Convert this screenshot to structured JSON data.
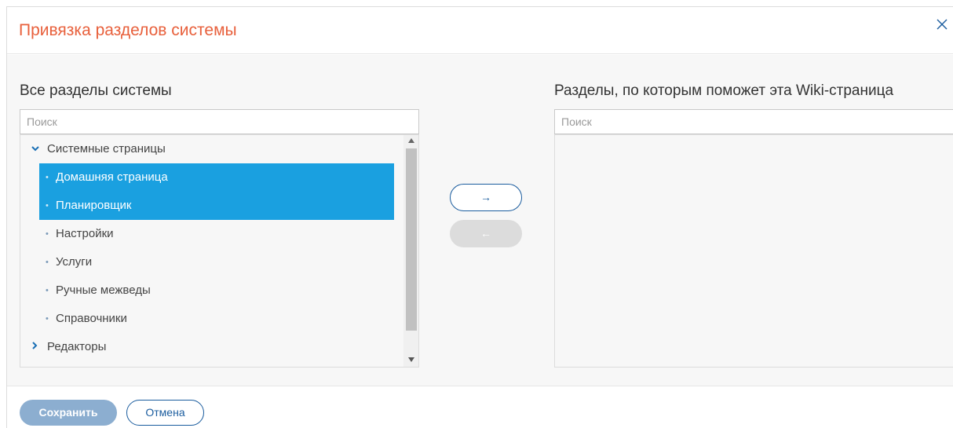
{
  "dialog": {
    "title": "Привязка разделов системы",
    "close_icon": "close-icon"
  },
  "left_panel": {
    "title": "Все разделы системы",
    "search_placeholder": "Поиск",
    "tree": {
      "group_1": {
        "label": "Системные страницы",
        "expanded": true
      },
      "items": [
        {
          "label": "Домашняя страница",
          "selected": true
        },
        {
          "label": "Планировщик",
          "selected": true
        },
        {
          "label": "Настройки",
          "selected": false
        },
        {
          "label": "Услуги",
          "selected": false
        },
        {
          "label": "Ручные межведы",
          "selected": false
        },
        {
          "label": "Справочники",
          "selected": false
        }
      ],
      "group_2": {
        "label": "Редакторы",
        "expanded": false
      }
    }
  },
  "right_panel": {
    "title": "Разделы, по которым поможет эта Wiki-страница",
    "search_placeholder": "Поиск"
  },
  "transfer": {
    "move_right_label": "→",
    "move_left_label": "←"
  },
  "footer": {
    "save_label": "Сохранить",
    "cancel_label": "Отмена"
  },
  "colors": {
    "title": "#e8603c",
    "selected": "#1aa0e0",
    "primary": "#1a5c9e",
    "save_disabled": "#8caed0"
  }
}
